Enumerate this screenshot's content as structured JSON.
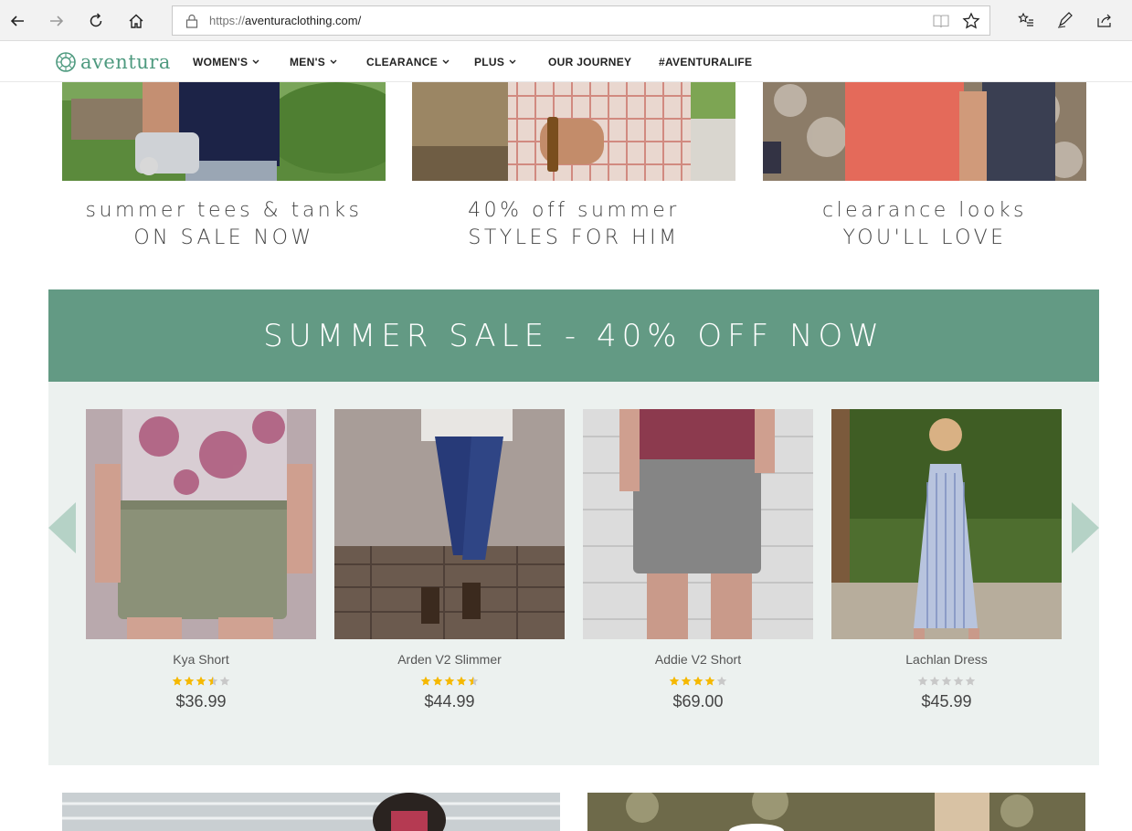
{
  "browser": {
    "url_protocol": "https://",
    "url_host": "aventuraclothing.com/"
  },
  "site": {
    "logo_text": "aventura",
    "nav": [
      {
        "label": "WOMEN'S",
        "has_dropdown": true
      },
      {
        "label": "MEN'S",
        "has_dropdown": true
      },
      {
        "label": "CLEARANCE",
        "has_dropdown": true
      },
      {
        "label": "PLUS",
        "has_dropdown": true
      },
      {
        "label": "OUR JOURNEY",
        "has_dropdown": false
      },
      {
        "label": "#AVENTURALIFE",
        "has_dropdown": false
      }
    ]
  },
  "hero": [
    {
      "line1": "summer tees & tanks",
      "line2": "ON SALE NOW"
    },
    {
      "line1": "40% off summer",
      "line2": "STYLES FOR HIM"
    },
    {
      "line1": "clearance looks",
      "line2": "YOU'LL LOVE"
    }
  ],
  "sale": {
    "banner": "SUMMER SALE - 40% OFF NOW"
  },
  "products": [
    {
      "name": "Kya Short",
      "price": "$36.99",
      "rating": 3.5
    },
    {
      "name": "Arden V2 Slimmer",
      "price": "$44.99",
      "rating": 4.5
    },
    {
      "name": "Addie V2 Short",
      "price": "$69.00",
      "rating": 4
    },
    {
      "name": "Lachlan Dress",
      "price": "$45.99",
      "rating": 0
    }
  ],
  "colors": {
    "brand_green": "#639a84",
    "carousel_bg": "#ecf1ef",
    "star_filled": "#f5b800",
    "star_empty": "#c8c8c8"
  }
}
